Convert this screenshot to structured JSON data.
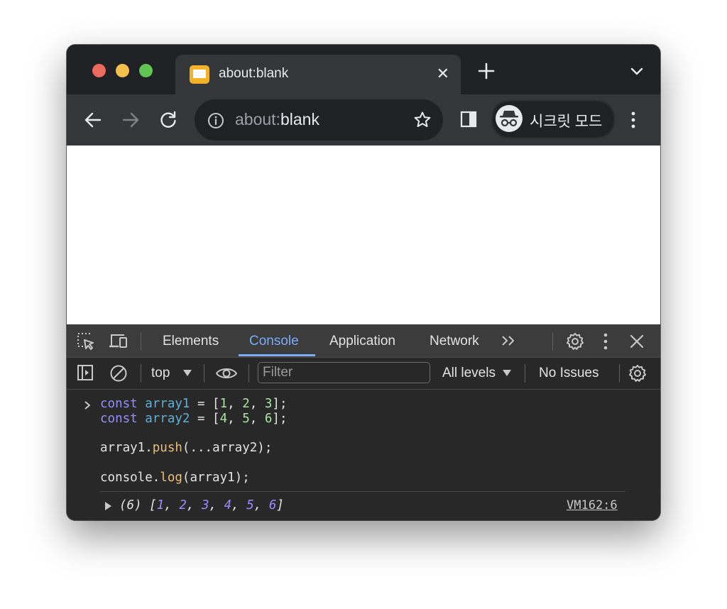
{
  "window": {
    "tab": {
      "title": "about:blank",
      "close_glyph": "✕"
    },
    "new_tab_icon": "plus-icon",
    "tab_search_icon": "chevron-down-icon"
  },
  "toolbar": {
    "back_icon": "arrow-left-icon",
    "forward_icon": "arrow-right-icon",
    "reload_icon": "reload-icon",
    "omnibox": {
      "scheme": "about:",
      "host": "blank",
      "info_icon": "info-icon",
      "star_icon": "star-icon"
    },
    "side_panel_icon": "side-panel-icon",
    "incognito": {
      "label": "시크릿 모드",
      "icon": "incognito-icon"
    },
    "menu_icon": "more-vert-icon"
  },
  "devtools": {
    "tabs": [
      {
        "label": "Elements"
      },
      {
        "label": "Console",
        "active": true
      },
      {
        "label": "Application"
      },
      {
        "label": "Network"
      }
    ],
    "more_tabs_glyph": ">>",
    "console_toolbar": {
      "context": "top",
      "filter_placeholder": "Filter",
      "levels": "All levels",
      "issues": "No Issues"
    },
    "console": {
      "input_lines": [
        "const array1 = [1, 2, 3];",
        "const array2 = [4, 5, 6];",
        "array1.push(...array2);",
        "console.log(array1);"
      ],
      "result": {
        "count": "(6)",
        "values": [
          "1",
          "2",
          "3",
          "4",
          "5",
          "6"
        ]
      },
      "source_link": "VM162:6"
    }
  },
  "colors": {
    "accent": "#7cacf8",
    "keyword": "#9a8dff",
    "variable": "#5db0d7",
    "number": "#a8e6a0",
    "function": "#e5c07b"
  }
}
